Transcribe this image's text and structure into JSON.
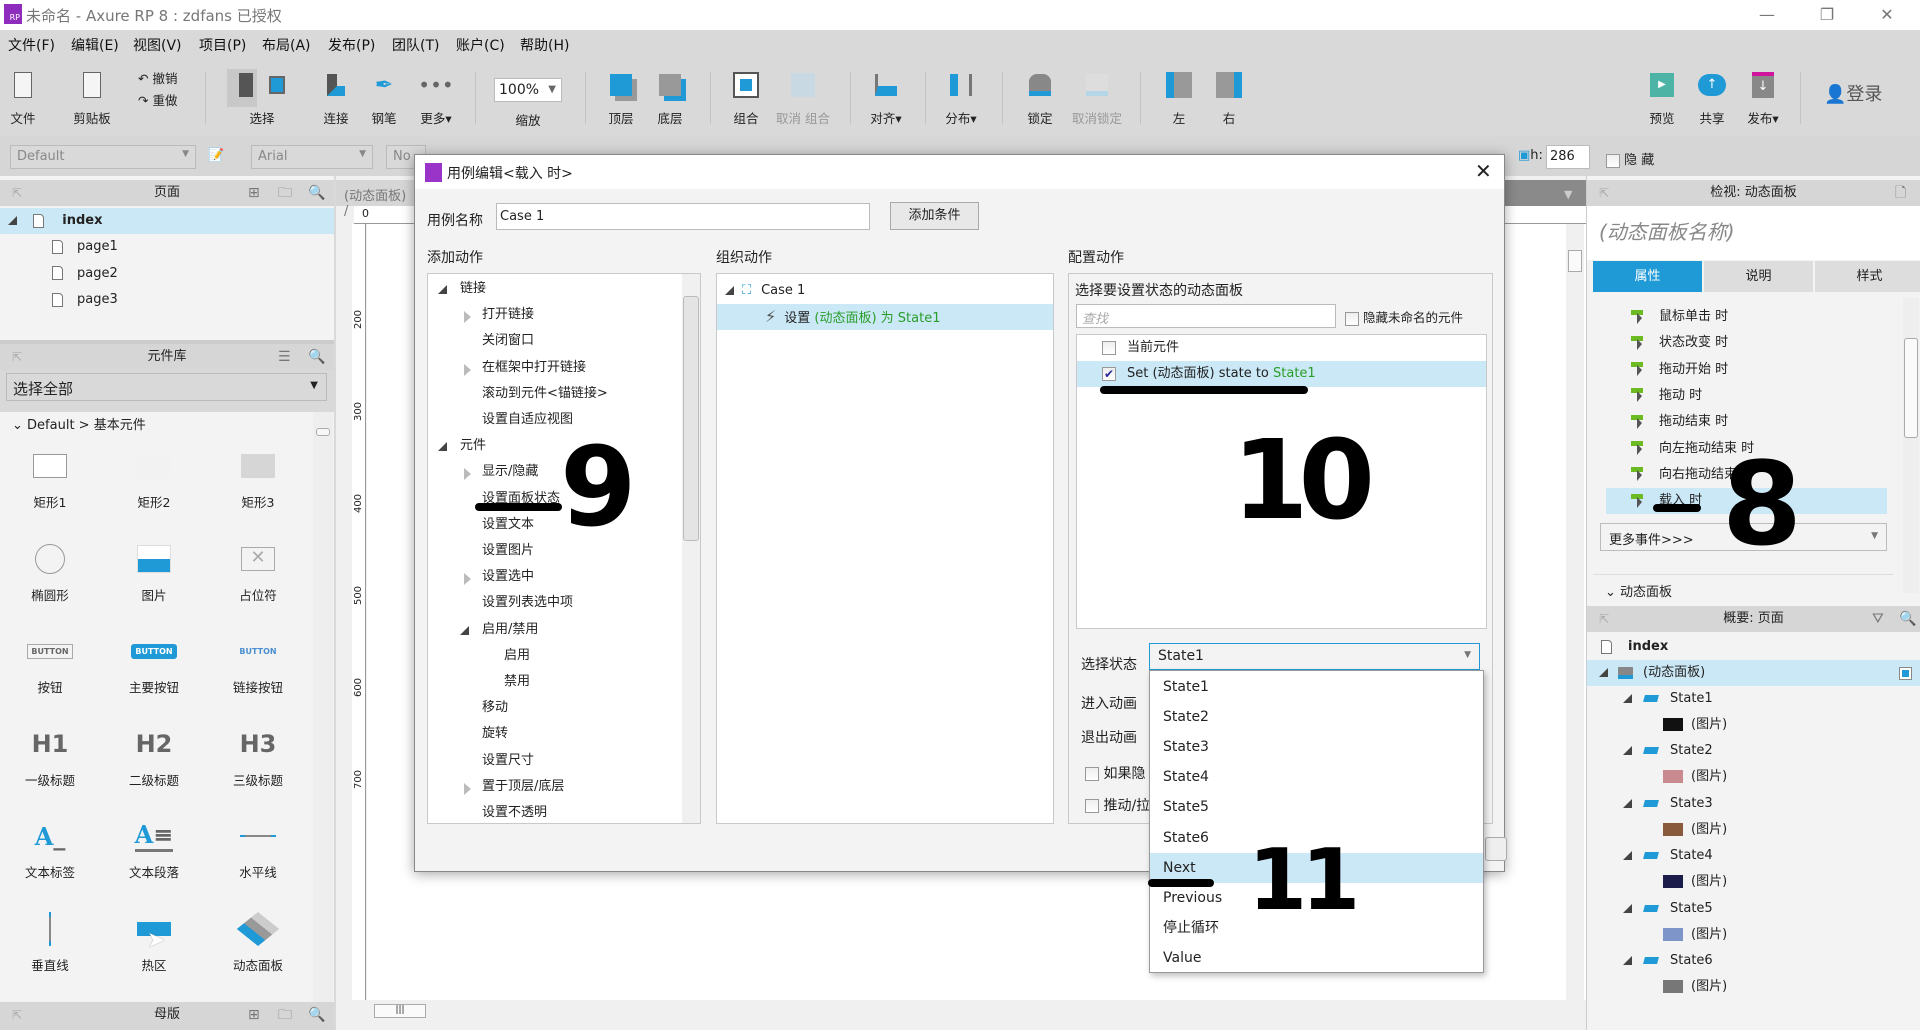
{
  "window": {
    "title": "未命名 - Axure RP 8 : zdfans 已授权",
    "logo": "RP"
  },
  "menu": [
    "文件(F)",
    "编辑(E)",
    "视图(V)",
    "项目(P)",
    "布局(A)",
    "发布(P)",
    "团队(T)",
    "账户(C)",
    "帮助(H)"
  ],
  "toolbar": {
    "file": "文件",
    "clipboard": "剪贴板",
    "undo": "撤销",
    "redo": "重做",
    "select": "选择",
    "connect": "连接",
    "pen": "钢笔",
    "more": "更多▾",
    "zoom_value": "100%",
    "zoom": "缩放",
    "top": "顶层",
    "bottom": "底层",
    "group": "组合",
    "ungroup": "取消 组合",
    "align": "对齐▾",
    "distribute": "分布▾",
    "lock": "锁定",
    "unlock": "取消锁定",
    "left": "左",
    "right": "右",
    "preview": "预览",
    "share": "共享",
    "publish": "发布▾",
    "login": "登录"
  },
  "format_bar": {
    "style": "Default",
    "font": "Arial",
    "weight": "No",
    "h_label": "h:",
    "h_value": "286",
    "hidden_label": "隐 藏"
  },
  "pages_panel": {
    "title": "页面",
    "root": "index",
    "pages": [
      "page1",
      "page2",
      "page3"
    ]
  },
  "library_panel": {
    "title": "元件库",
    "filter": "选择全部",
    "group": "Default > 基本元件",
    "widgets": [
      "矩形1",
      "矩形2",
      "矩形3",
      "椭圆形",
      "图片",
      "占位符",
      "按钮",
      "主要按钮",
      "链接按钮",
      "一级标题",
      "二级标题",
      "三级标题",
      "文本标签",
      "文本段落",
      "水平线",
      "垂直线",
      "热区",
      "动态面板"
    ],
    "button_text": "BUTTON",
    "h1": "H1",
    "h2": "H2",
    "h3": "H3"
  },
  "masters_panel": {
    "title": "母版"
  },
  "canvas": {
    "tab": "(动态面板) /",
    "ruler_top": "0",
    "ruler_left": [
      "200",
      "300",
      "400",
      "500",
      "600",
      "700"
    ]
  },
  "inspector": {
    "title": "检视: 动态面板",
    "name_placeholder": "(动态面板名称)",
    "tabs": [
      "属性",
      "说明",
      "样式"
    ],
    "events": [
      "鼠标单击 时",
      "状态改变 时",
      "拖动开始 时",
      "拖动 时",
      "拖动结束 时",
      "向左拖动结束 时",
      "向右拖动结束 时",
      "载入 时"
    ],
    "selected_event": "载入 时",
    "more_events": "更多事件>>>",
    "section": "动态面板"
  },
  "outline": {
    "title": "概要: 页面",
    "page": "index",
    "panel": "(动态面板)",
    "states": [
      {
        "name": "State1",
        "child": "(图片)",
        "thumb": "#111111"
      },
      {
        "name": "State2",
        "child": "(图片)",
        "thumb": "#c98a8f"
      },
      {
        "name": "State3",
        "child": "(图片)",
        "thumb": "#8a5a3c"
      },
      {
        "name": "State4",
        "child": "(图片)",
        "thumb": "#1c1c4a"
      },
      {
        "name": "State5",
        "child": "(图片)",
        "thumb": "#7d95c8"
      },
      {
        "name": "State6",
        "child": "(图片)",
        "thumb": "#777777"
      }
    ]
  },
  "dialog": {
    "title": "用例编辑<载入 时>",
    "case_name_label": "用例名称",
    "case_name": "Case 1",
    "add_condition": "添加条件",
    "add_action_label": "添加动作",
    "organize_label": "组织动作",
    "configure_label": "配置动作",
    "actions": [
      {
        "label": "链接",
        "level": 0,
        "toggle": "open"
      },
      {
        "label": "打开链接",
        "level": 1,
        "toggle": "closed"
      },
      {
        "label": "关闭窗口",
        "level": 1,
        "toggle": ""
      },
      {
        "label": "在框架中打开链接",
        "level": 1,
        "toggle": "closed"
      },
      {
        "label": "滚动到元件<锚链接>",
        "level": 1,
        "toggle": ""
      },
      {
        "label": "设置自适应视图",
        "level": 1,
        "toggle": ""
      },
      {
        "label": "元件",
        "level": 0,
        "toggle": "open"
      },
      {
        "label": "显示/隐藏",
        "level": 1,
        "toggle": "closed"
      },
      {
        "label": "设置面板状态",
        "level": 1,
        "toggle": ""
      },
      {
        "label": "设置文本",
        "level": 1,
        "toggle": ""
      },
      {
        "label": "设置图片",
        "level": 1,
        "toggle": ""
      },
      {
        "label": "设置选中",
        "level": 1,
        "toggle": "closed"
      },
      {
        "label": "设置列表选中项",
        "level": 1,
        "toggle": ""
      },
      {
        "label": "启用/禁用",
        "level": 1,
        "toggle": "open"
      },
      {
        "label": "启用",
        "level": 2,
        "toggle": ""
      },
      {
        "label": "禁用",
        "level": 2,
        "toggle": ""
      },
      {
        "label": "移动",
        "level": 1,
        "toggle": ""
      },
      {
        "label": "旋转",
        "level": 1,
        "toggle": ""
      },
      {
        "label": "设置尺寸",
        "level": 1,
        "toggle": ""
      },
      {
        "label": "置于顶层/底层",
        "level": 1,
        "toggle": "closed"
      },
      {
        "label": "设置不透明",
        "level": 1,
        "toggle": ""
      }
    ],
    "organize": {
      "case": "Case 1",
      "action_prefix": "设置",
      "action_target": "(动态面板) 为 State1"
    },
    "configure": {
      "title": "选择要设置状态的动态面板",
      "search_placeholder": "查找",
      "hide_unnamed": "隐藏未命名的元件",
      "items": [
        {
          "label": "当前元件",
          "checked": false
        },
        {
          "label": "Set (动态面板) state to ",
          "highlight": "State1",
          "checked": true
        }
      ],
      "select_state_label": "选择状态",
      "select_state_value": "State1",
      "enter_anim_label": "进入动画",
      "exit_anim_label": "退出动画",
      "option1": "如果隐",
      "option2": "推动/拉"
    },
    "state_options": [
      "State1",
      "State2",
      "State3",
      "State4",
      "State5",
      "State6",
      "Next",
      "Previous",
      "停止循环",
      "Value"
    ],
    "hovered_option": "Next"
  },
  "annotations": {
    "a8": "8",
    "a9": "9",
    "a10": "10",
    "a11": "11"
  }
}
